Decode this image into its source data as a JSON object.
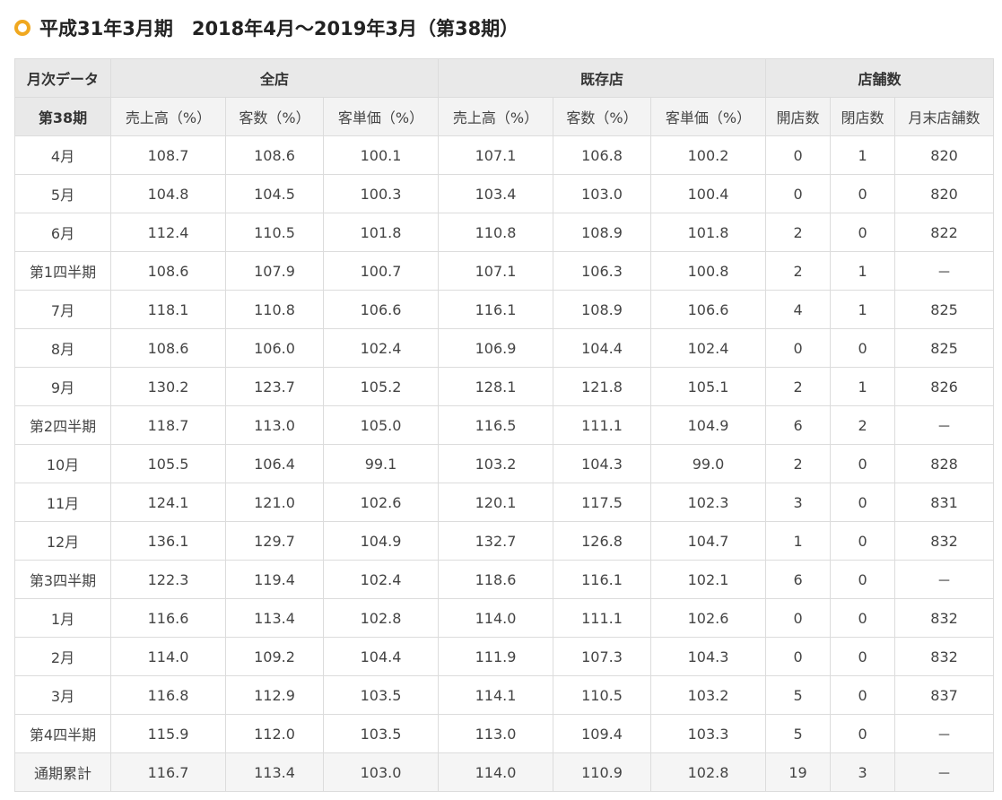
{
  "title": "平成31年3月期　2018年4月～2019年3月（第38期）",
  "table": {
    "group_headers": [
      "月次データ",
      "全店",
      "既存店",
      "店舗数"
    ],
    "sub_headers": [
      "第38期",
      "売上高（%）",
      "客数（%）",
      "客単価（%）",
      "売上高（%）",
      "客数（%）",
      "客単価（%）",
      "開店数",
      "閉店数",
      "月末店舗数"
    ],
    "rows": [
      [
        "4月",
        "108.7",
        "108.6",
        "100.1",
        "107.1",
        "106.8",
        "100.2",
        "0",
        "1",
        "820"
      ],
      [
        "5月",
        "104.8",
        "104.5",
        "100.3",
        "103.4",
        "103.0",
        "100.4",
        "0",
        "0",
        "820"
      ],
      [
        "6月",
        "112.4",
        "110.5",
        "101.8",
        "110.8",
        "108.9",
        "101.8",
        "2",
        "0",
        "822"
      ],
      [
        "第1四半期",
        "108.6",
        "107.9",
        "100.7",
        "107.1",
        "106.3",
        "100.8",
        "2",
        "1",
        "－"
      ],
      [
        "7月",
        "118.1",
        "110.8",
        "106.6",
        "116.1",
        "108.9",
        "106.6",
        "4",
        "1",
        "825"
      ],
      [
        "8月",
        "108.6",
        "106.0",
        "102.4",
        "106.9",
        "104.4",
        "102.4",
        "0",
        "0",
        "825"
      ],
      [
        "9月",
        "130.2",
        "123.7",
        "105.2",
        "128.1",
        "121.8",
        "105.1",
        "2",
        "1",
        "826"
      ],
      [
        "第2四半期",
        "118.7",
        "113.0",
        "105.0",
        "116.5",
        "111.1",
        "104.9",
        "6",
        "2",
        "－"
      ],
      [
        "10月",
        "105.5",
        "106.4",
        "99.1",
        "103.2",
        "104.3",
        "99.0",
        "2",
        "0",
        "828"
      ],
      [
        "11月",
        "124.1",
        "121.0",
        "102.6",
        "120.1",
        "117.5",
        "102.3",
        "3",
        "0",
        "831"
      ],
      [
        "12月",
        "136.1",
        "129.7",
        "104.9",
        "132.7",
        "126.8",
        "104.7",
        "1",
        "0",
        "832"
      ],
      [
        "第3四半期",
        "122.3",
        "119.4",
        "102.4",
        "118.6",
        "116.1",
        "102.1",
        "6",
        "0",
        "－"
      ],
      [
        "1月",
        "116.6",
        "113.4",
        "102.8",
        "114.0",
        "111.1",
        "102.6",
        "0",
        "0",
        "832"
      ],
      [
        "2月",
        "114.0",
        "109.2",
        "104.4",
        "111.9",
        "107.3",
        "104.3",
        "0",
        "0",
        "832"
      ],
      [
        "3月",
        "116.8",
        "112.9",
        "103.5",
        "114.1",
        "110.5",
        "103.2",
        "5",
        "0",
        "837"
      ],
      [
        "第4四半期",
        "115.9",
        "112.0",
        "103.5",
        "113.0",
        "109.4",
        "103.3",
        "5",
        "0",
        "－"
      ],
      [
        "通期累計",
        "116.7",
        "113.4",
        "103.0",
        "114.0",
        "110.9",
        "102.8",
        "19",
        "3",
        "－"
      ]
    ]
  },
  "colors": {
    "accent": "#f0a820",
    "header_bg": "#e9e9e9",
    "subheader_bg": "#f3f3f3",
    "total_row_bg": "#f5f5f5",
    "border": "#dcdcdc"
  },
  "icons": {
    "title_marker": "circle-bullet-icon"
  }
}
